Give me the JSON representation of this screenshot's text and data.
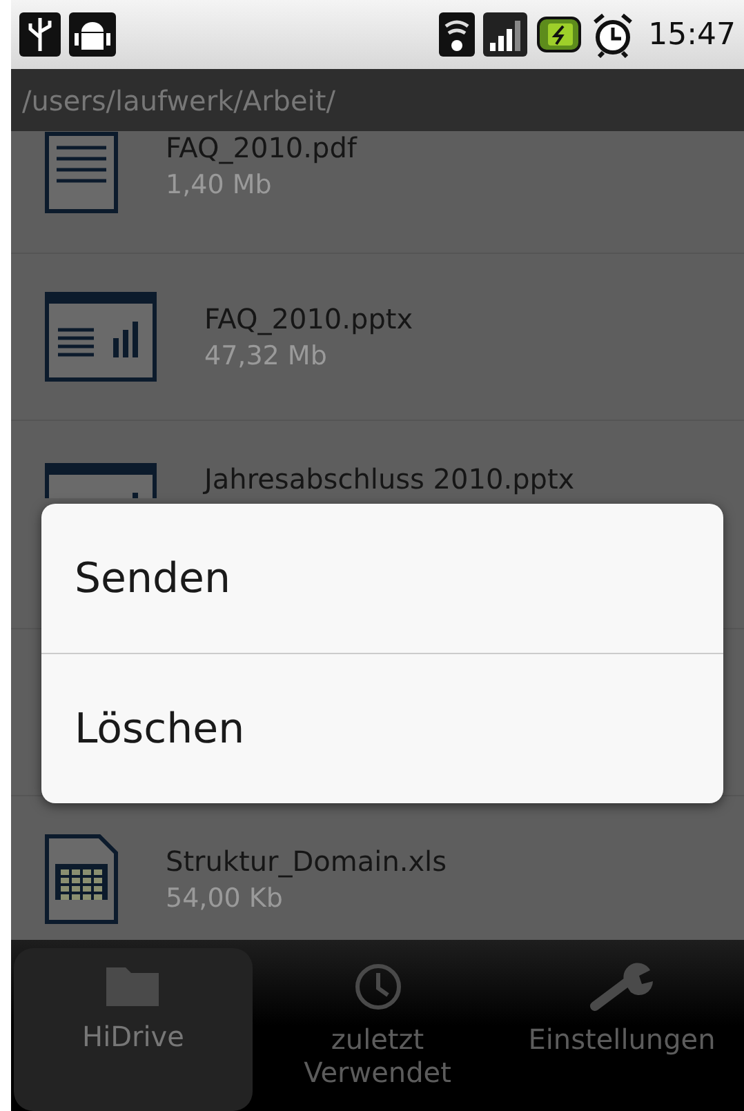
{
  "status_bar": {
    "time": "15:47"
  },
  "path": "/users/laufwerk/Arbeit/",
  "files": [
    {
      "kind": "doc",
      "name": "FAQ_2010.pdf",
      "size": "1,40 Mb"
    },
    {
      "kind": "slides",
      "name": "FAQ_2010.pptx",
      "size": "47,32 Mb"
    },
    {
      "kind": "slides",
      "name": "Jahresabschluss 2010.pptx",
      "clipped": true
    },
    {
      "kind": "hidden"
    },
    {
      "kind": "sheet",
      "name": "Struktur_Domain.xls",
      "size": "54,00 Kb"
    }
  ],
  "dialog": {
    "items": [
      "Senden",
      "Löschen"
    ]
  },
  "nav": [
    {
      "kind": "folder",
      "label": "HiDrive",
      "selected": true
    },
    {
      "kind": "clock",
      "label": "zuletzt Verwendet",
      "selected": false
    },
    {
      "kind": "wrench",
      "label": "Einstellungen",
      "selected": false
    }
  ]
}
